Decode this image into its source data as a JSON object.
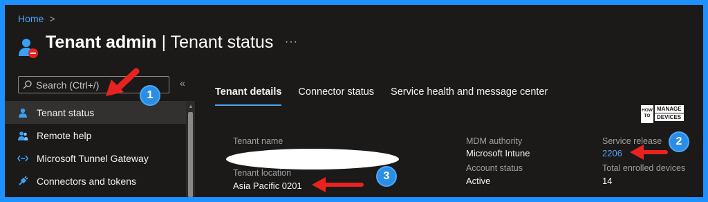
{
  "breadcrumb": {
    "home": "Home",
    "sep": ">"
  },
  "page": {
    "title_bold": "Tenant admin",
    "title_sep": " | ",
    "title_rest": "Tenant status",
    "more": "···"
  },
  "search": {
    "placeholder": "Search (Ctrl+/)",
    "collapse": "«"
  },
  "sidebar": {
    "items": [
      {
        "label": "Tenant status",
        "icon": "person-icon",
        "active": true
      },
      {
        "label": "Remote help",
        "icon": "people-icon"
      },
      {
        "label": "Microsoft Tunnel Gateway",
        "icon": "tunnel-icon"
      },
      {
        "label": "Connectors and tokens",
        "icon": "plug-icon"
      }
    ]
  },
  "tabs": [
    {
      "label": "Tenant details",
      "active": true
    },
    {
      "label": "Connector status"
    },
    {
      "label": "Service health and message center"
    }
  ],
  "logo": {
    "how": "HOW TO",
    "manage": "MANAGE",
    "devices": "DEVICES"
  },
  "details": {
    "tenant_name_label": "Tenant name",
    "tenant_location_label": "Tenant location",
    "tenant_location_value": "Asia Pacific 0201",
    "mdm_label": "MDM authority",
    "mdm_value": "Microsoft Intune",
    "account_label": "Account status",
    "account_value": "Active",
    "release_label": "Service release",
    "release_value": "2206",
    "enrolled_label": "Total enrolled devices",
    "enrolled_value": "14"
  },
  "annotations": {
    "badge1": "1",
    "badge2": "2",
    "badge3": "3"
  },
  "colors": {
    "accent": "#4fa3f7",
    "frame": "#1e90ff",
    "arrow": "#e8231f",
    "badge": "#2b8de3"
  }
}
